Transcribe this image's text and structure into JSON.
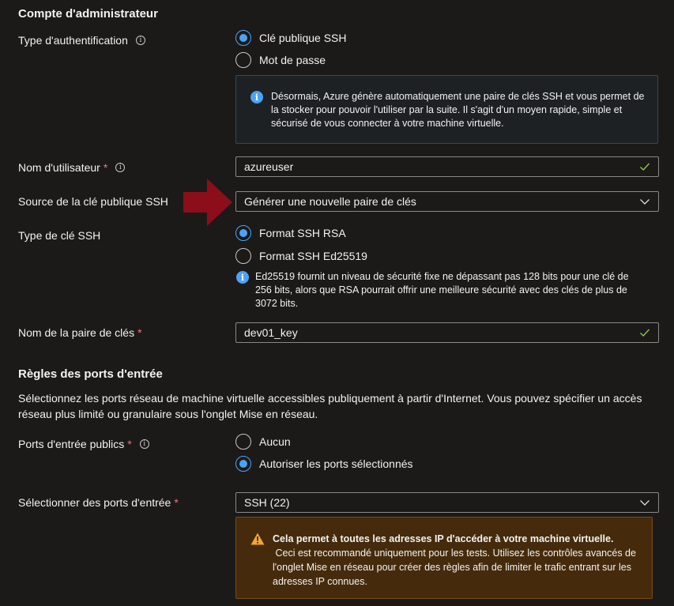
{
  "admin": {
    "title": "Compte d'administrateur",
    "auth_type": {
      "label": "Type d'authentification",
      "options": [
        "Clé publique SSH",
        "Mot de passe"
      ],
      "selected": 0,
      "info_box": "Désormais, Azure génère automatiquement une paire de clés SSH et vous permet de la stocker pour pouvoir l'utiliser par la suite. Il s'agit d'un moyen rapide, simple et sécurisé de vous connecter à votre machine virtuelle."
    },
    "username": {
      "label": "Nom d'utilisateur",
      "value": "azureuser"
    },
    "key_source": {
      "label": "Source de la clé publique SSH",
      "value": "Générer une nouvelle paire de clés"
    },
    "key_type": {
      "label": "Type de clé SSH",
      "options": [
        "Format SSH RSA",
        "Format SSH Ed25519"
      ],
      "selected": 0,
      "info": "Ed25519 fournit un niveau de sécurité fixe ne dépassant pas 128 bits pour une clé de 256 bits, alors que RSA pourrait offrir une meilleure sécurité avec des clés de plus de 3072 bits."
    },
    "key_pair_name": {
      "label": "Nom de la paire de clés",
      "value": "dev01_key"
    }
  },
  "inbound": {
    "title": "Règles des ports d'entrée",
    "description": "Sélectionnez les ports réseau de machine virtuelle accessibles publiquement à partir d'Internet. Vous pouvez spécifier un accès réseau plus limité ou granulaire sous l'onglet Mise en réseau.",
    "public_ports": {
      "label": "Ports d'entrée publics",
      "options": [
        "Aucun",
        "Autoriser les ports sélectionnés"
      ],
      "selected": 1
    },
    "select_ports": {
      "label": "Sélectionner des ports d'entrée",
      "value": "SSH (22)"
    },
    "warning": {
      "bold": "Cela permet à toutes les adresses IP d'accéder à votre machine virtuelle.",
      "text": "Ceci est recommandé uniquement pour les tests. Utilisez les contrôles avancés de l'onglet Mise en réseau pour créer des règles afin de limiter le trafic entrant sur les adresses IP connues."
    }
  },
  "colors": {
    "accent": "#4ca3f5",
    "success": "#92c353",
    "required": "#f1707b",
    "arrow": "#8b0e1a",
    "warning_bg": "#452b0c"
  }
}
